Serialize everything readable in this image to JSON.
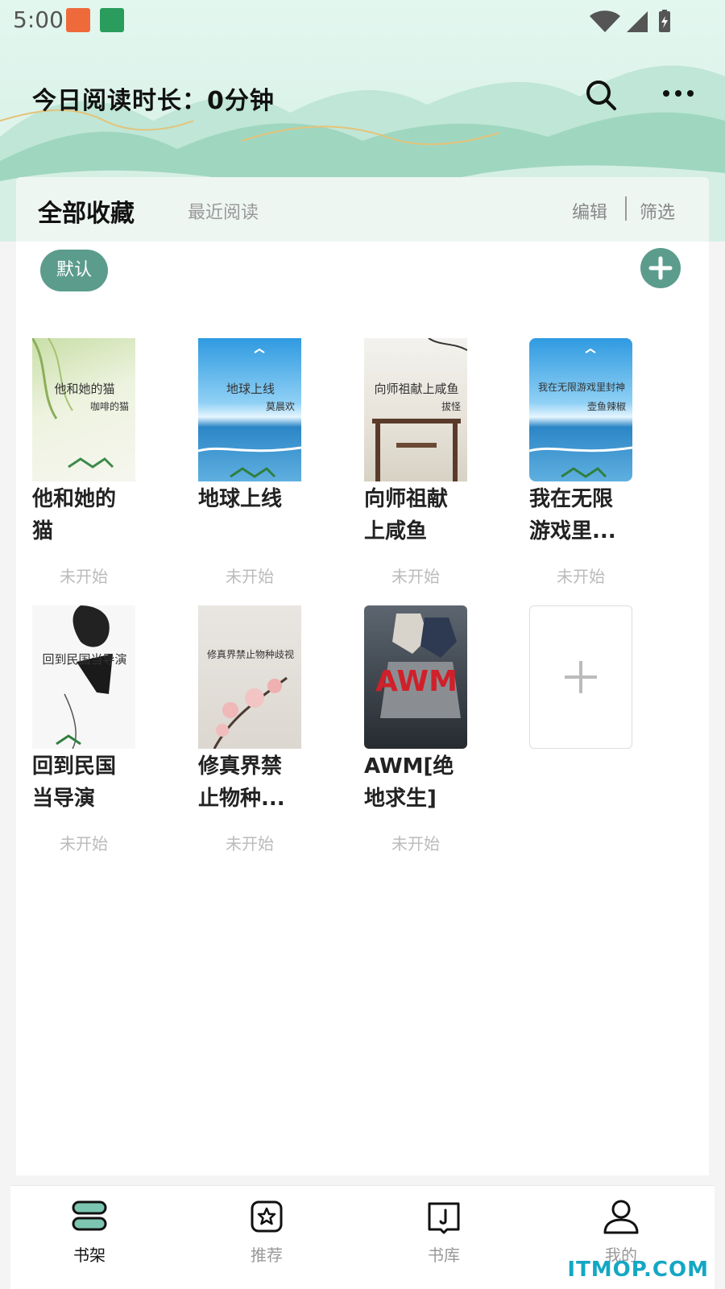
{
  "status_bar": {
    "time": "5:00"
  },
  "header": {
    "reading_time": "今日阅读时长：0分钟"
  },
  "tabs": {
    "all": "全部收藏",
    "recent": "最近阅读",
    "edit": "编辑",
    "filter": "筛选"
  },
  "group": {
    "default_chip": "默认"
  },
  "books": [
    {
      "title_line1": "他和她的",
      "title_line2": "猫",
      "status": "未开始",
      "cover_title": "他和她的猫",
      "cover_author": "咖啡的猫"
    },
    {
      "title_line1": "地球上线",
      "title_line2": "",
      "status": "未开始",
      "cover_title": "地球上线",
      "cover_author": "莫晨欢"
    },
    {
      "title_line1": "向师祖献",
      "title_line2": "上咸鱼",
      "status": "未开始",
      "cover_title": "向师祖献上咸鱼",
      "cover_author": "拔怪"
    },
    {
      "title_line1": "我在无限",
      "title_line2": "游戏里...",
      "status": "未开始",
      "cover_title": "我在无限游戏里封神",
      "cover_author": "壶鱼辣椒"
    },
    {
      "title_line1": "回到民国",
      "title_line2": "当导演",
      "status": "未开始",
      "cover_title": "回到民国当导演",
      "cover_author": ""
    },
    {
      "title_line1": "修真界禁",
      "title_line2": "止物种...",
      "status": "未开始",
      "cover_title": "修真界禁止物种歧视",
      "cover_author": ""
    },
    {
      "title_line1": "AWM[绝",
      "title_line2": "地求生]",
      "status": "未开始",
      "cover_title": "AWM",
      "cover_author": ""
    }
  ],
  "nav": [
    {
      "label": "书架",
      "active": true
    },
    {
      "label": "推荐",
      "active": false
    },
    {
      "label": "书库",
      "active": false
    },
    {
      "label": "我的",
      "active": false
    }
  ],
  "colors": {
    "accent": "#5c9c8d",
    "active_nav": "#111111",
    "inactive_nav": "#999999",
    "watermark": "#14a7c4"
  },
  "watermark": "ITMOP.COM"
}
